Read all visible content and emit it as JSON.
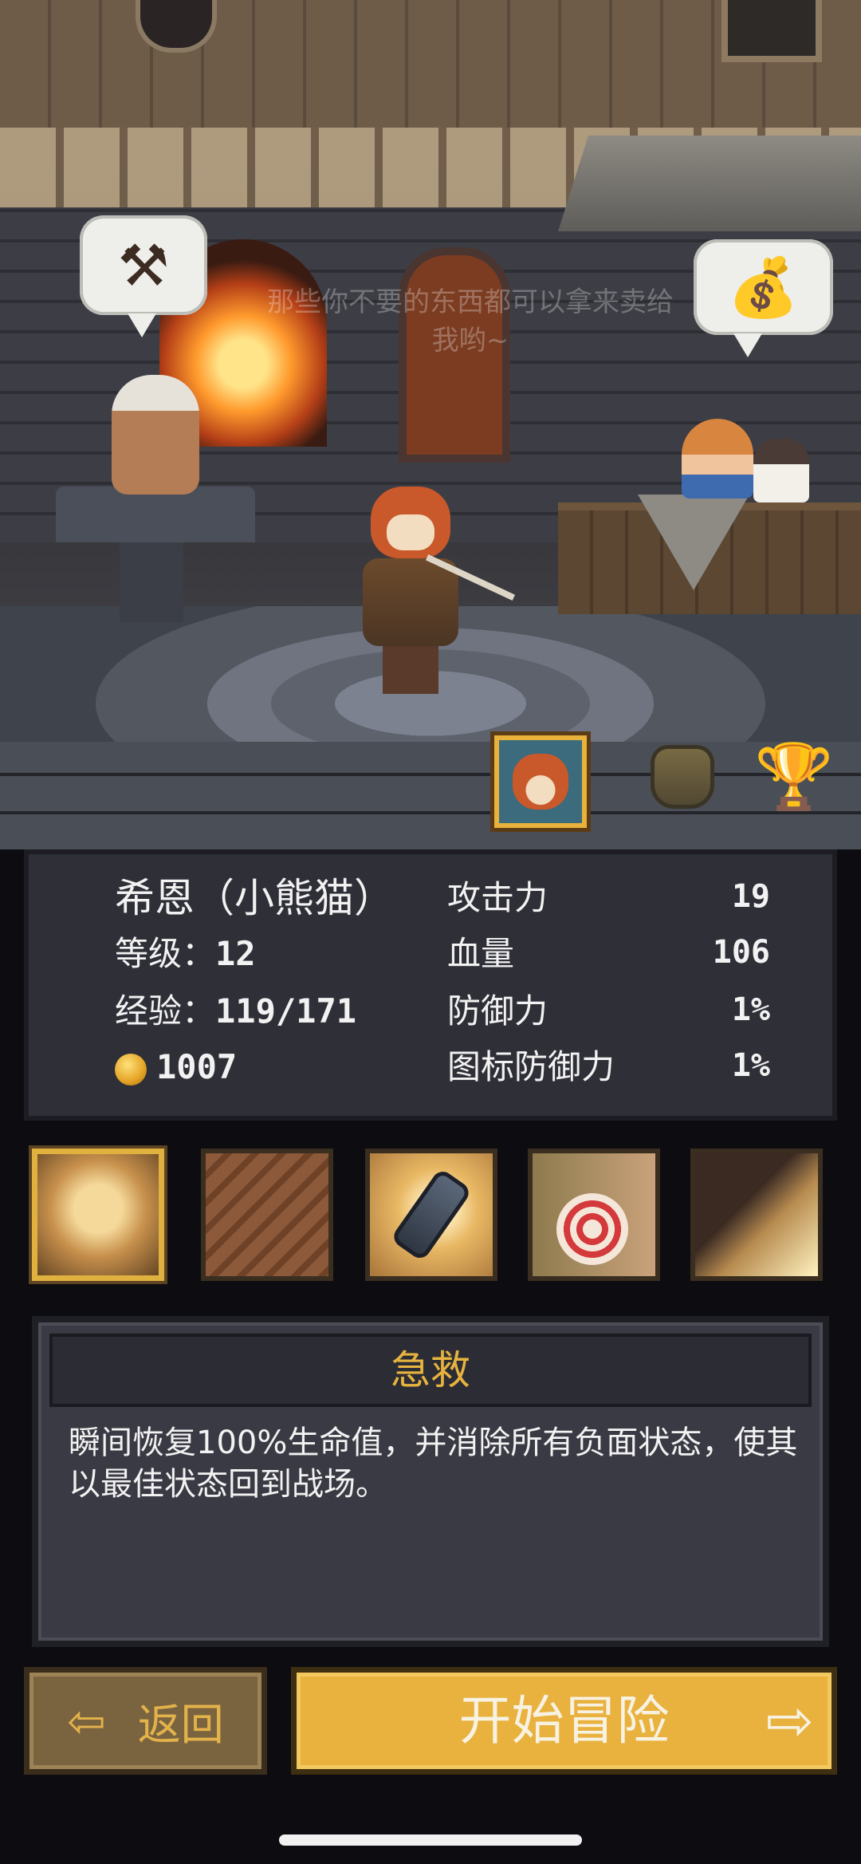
{
  "scene": {
    "faded_dialog": "那些你不要的东西都可以拿来卖给我哟~",
    "smith_bubble_icon": "hammer-icon",
    "shop_bubble_icon": "coin-bag-icon"
  },
  "tabs": [
    {
      "name": "hero-portrait-tab",
      "icon": "red-panda-portrait-icon"
    },
    {
      "name": "inventory-tab",
      "icon": "bag-icon"
    },
    {
      "name": "achievements-tab",
      "icon": "trophy-icon"
    }
  ],
  "character": {
    "name": "希恩（小熊猫）",
    "level_label": "等级：",
    "level": "12",
    "exp_label": "经验：",
    "exp": "119/171",
    "gold": "1007",
    "attack_label": "攻击力",
    "attack": "19",
    "hp_label": "血量",
    "hp": "106",
    "defense_label": "防御力",
    "defense": "1%",
    "icon_defense_label": "图标防御力",
    "icon_defense": "1%"
  },
  "skills": [
    {
      "icon": "first-aid-skill-icon",
      "selected": true
    },
    {
      "icon": "armor-skill-icon",
      "selected": false
    },
    {
      "icon": "potion-skill-icon",
      "selected": false
    },
    {
      "icon": "target-skill-icon",
      "selected": false
    },
    {
      "icon": "arrows-skill-icon",
      "selected": false
    }
  ],
  "selected_skill": {
    "title": "急救",
    "description": "瞬间恢复100%生命值，并消除所有负面状态，使其以最佳状态回到战场。"
  },
  "buttons": {
    "back_label": "返回",
    "start_label": "开始冒险"
  },
  "colors": {
    "accent_gold": "#e9b13d",
    "panel_bg": "#2f2f38",
    "title_gold": "#e7b33f"
  }
}
